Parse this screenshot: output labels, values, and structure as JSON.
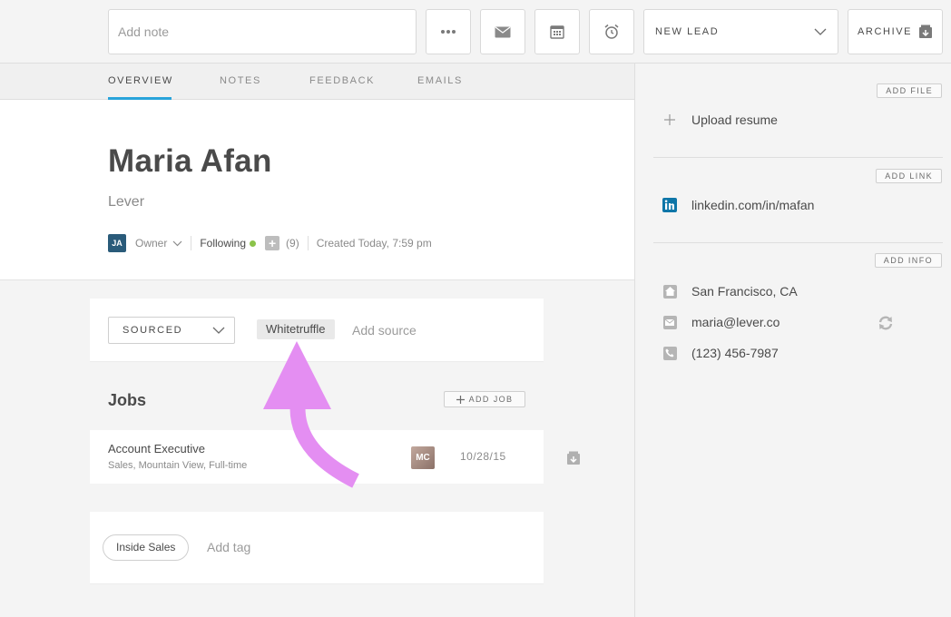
{
  "toolbar": {
    "note_placeholder": "Add note",
    "stage_label": "NEW LEAD",
    "archive_label": "ARCHIVE"
  },
  "tabs": [
    {
      "label": "OVERVIEW",
      "active": true
    },
    {
      "label": "NOTES"
    },
    {
      "label": "FEEDBACK"
    },
    {
      "label": "EMAILS"
    }
  ],
  "profile": {
    "name": "Maria Afan",
    "company": "Lever",
    "owner_initials": "JA",
    "owner_label": "Owner",
    "following_label": "Following",
    "followers_count": "(9)",
    "created": "Created Today, 7:59 pm"
  },
  "source": {
    "origin": "SOURCED",
    "tag": "Whitetruffle",
    "add_placeholder": "Add source"
  },
  "jobs": {
    "title": "Jobs",
    "add_label": "ADD JOB",
    "items": [
      {
        "title": "Account Executive",
        "subtitle": "Sales, Mountain View, Full-time",
        "avatar": "MC",
        "date": "10/28/15"
      }
    ]
  },
  "tags": {
    "items": [
      "Inside Sales"
    ],
    "add_placeholder": "Add tag"
  },
  "sidebar": {
    "add_file": "ADD FILE",
    "upload_resume": "Upload resume",
    "add_link": "ADD LINK",
    "linkedin": "linkedin.com/in/mafan",
    "add_info": "ADD INFO",
    "location": "San Francisco, CA",
    "email": "maria@lever.co",
    "phone": "(123) 456-7987"
  },
  "colors": {
    "accent": "#29a3da",
    "following_dot": "#8bc34a",
    "annotation_arrow": "#e48ef2",
    "linkedin": "#0e76a8"
  }
}
